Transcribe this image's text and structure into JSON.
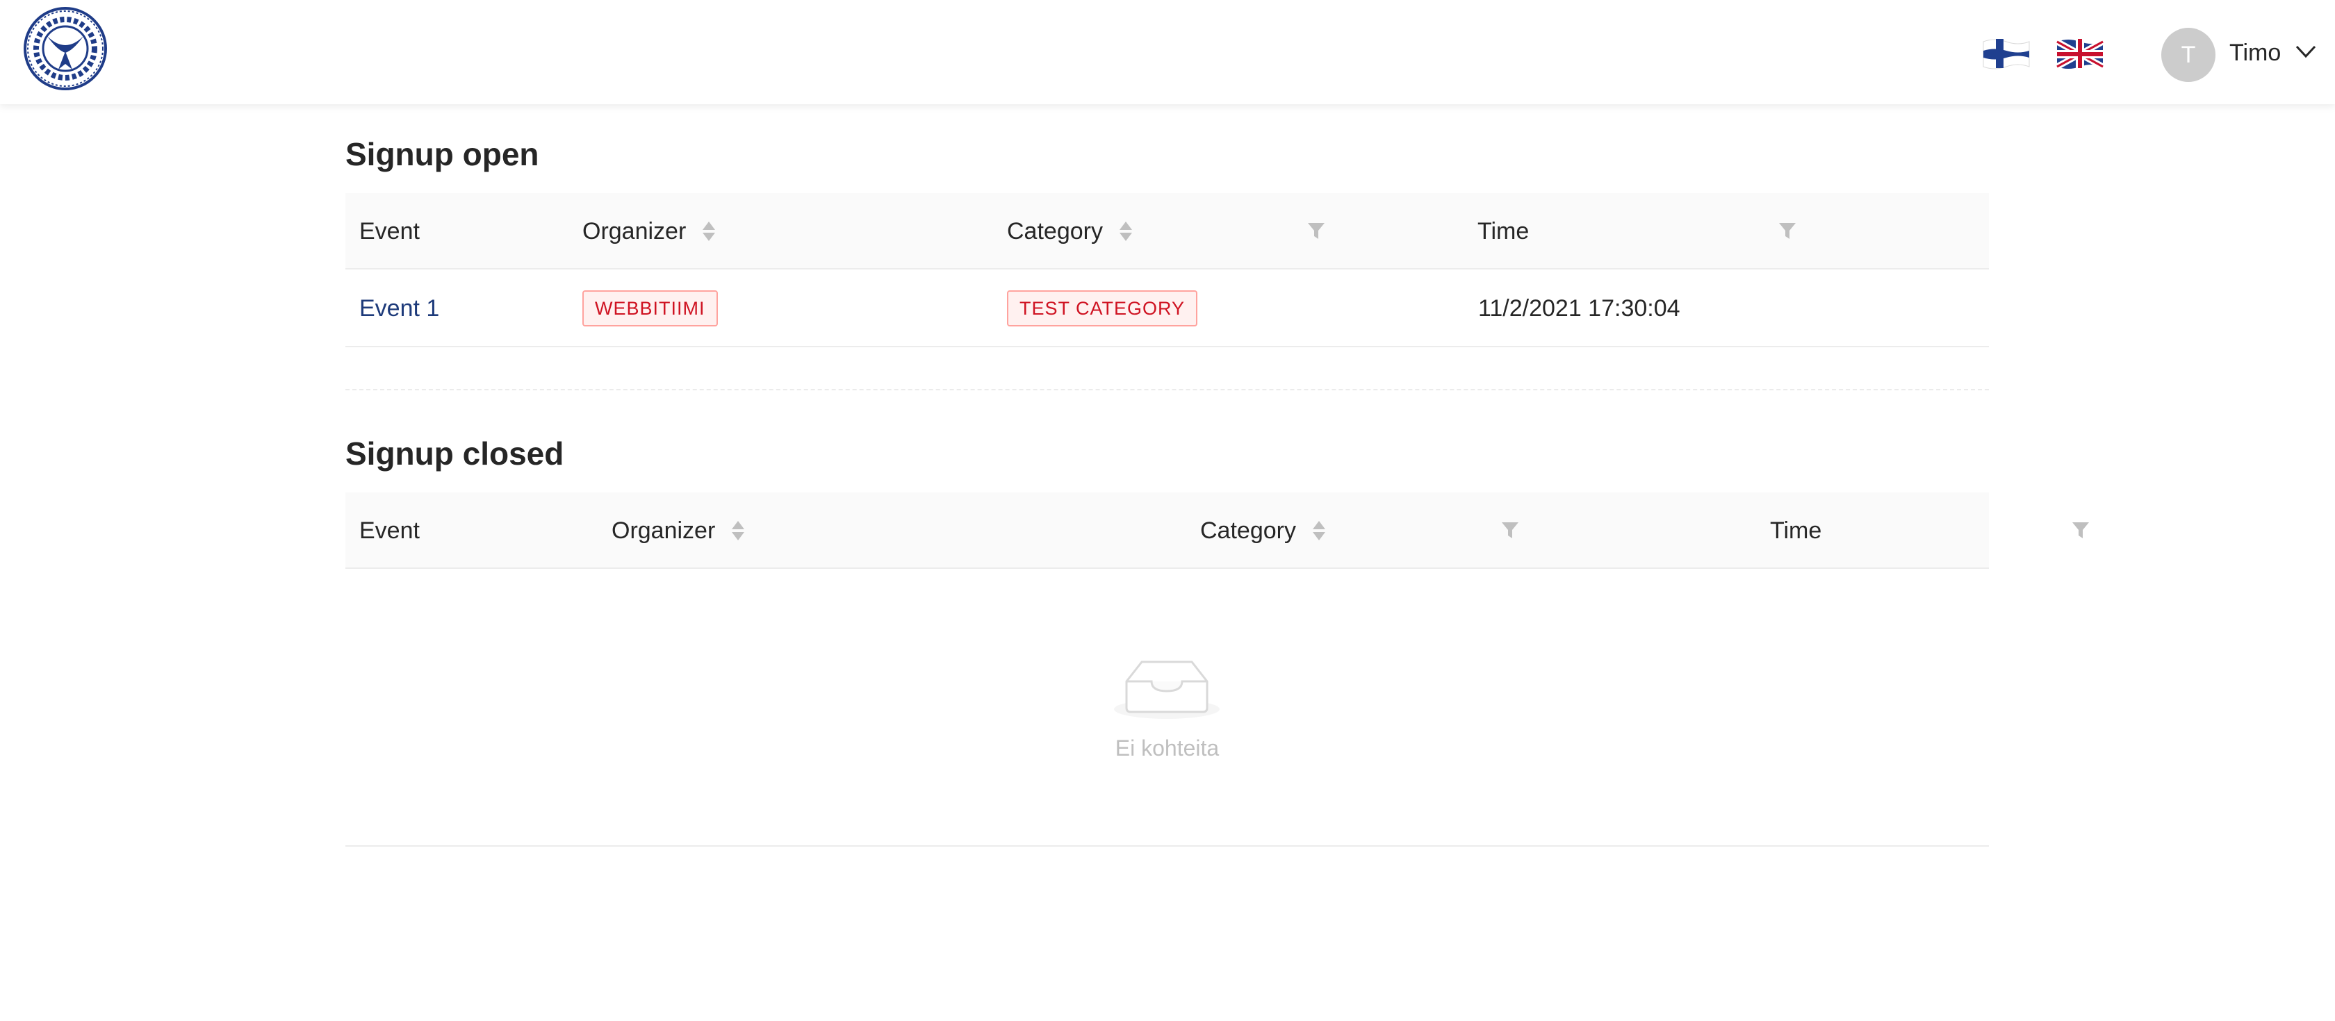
{
  "header": {
    "user": {
      "initial": "T",
      "name": "Timo"
    }
  },
  "signup_open": {
    "title": "Signup open",
    "columns": [
      "Event",
      "Organizer",
      "Category",
      "Time"
    ],
    "rows": [
      {
        "event": "Event 1",
        "organizer": "WEBBITIIMI",
        "category": "TEST CATEGORY",
        "time": "11/2/2021 17:30:04"
      }
    ]
  },
  "signup_closed": {
    "title": "Signup closed",
    "columns": [
      "Event",
      "Organizer",
      "Category",
      "Time"
    ],
    "empty_text": "Ei kohteita"
  },
  "colors": {
    "tag_border": "#ffa39e",
    "tag_background": "#fff1f0",
    "tag_text": "#cf1322",
    "link": "#1d3a7a"
  }
}
